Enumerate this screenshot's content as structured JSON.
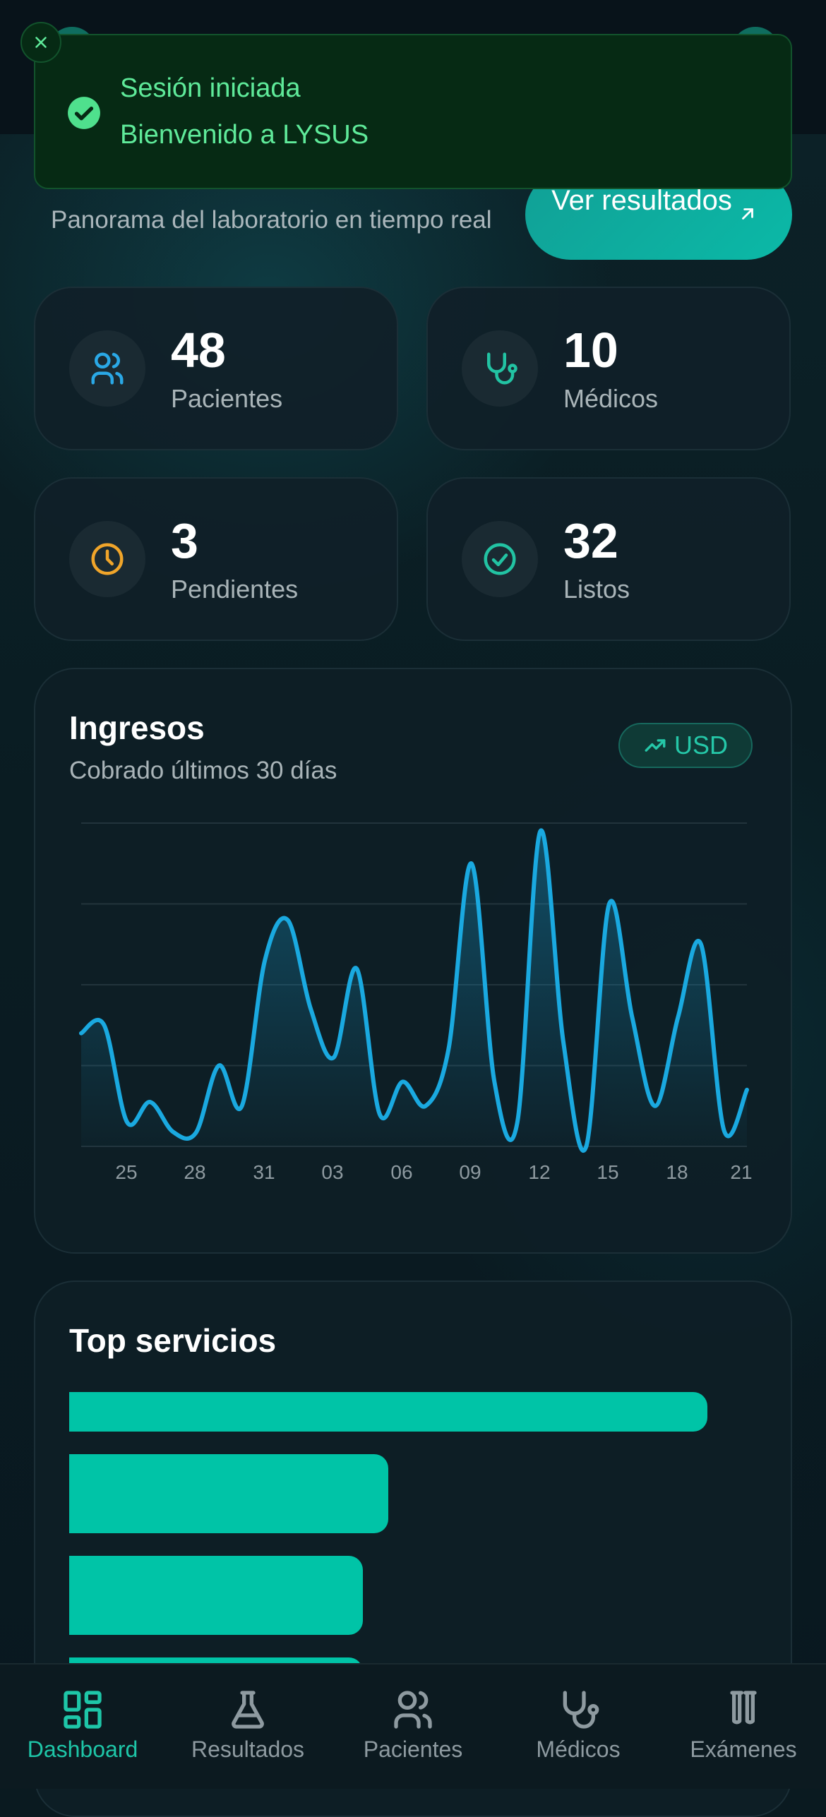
{
  "header": {
    "subtitle": "Panorama del laboratorio en tiempo real",
    "results_button": "Ver resultados"
  },
  "stats": [
    {
      "value": "48",
      "label": "Pacientes",
      "icon": "users-icon"
    },
    {
      "value": "10",
      "label": "Médicos",
      "icon": "stethoscope-icon"
    },
    {
      "value": "3",
      "label": "Pendientes",
      "icon": "clock-icon"
    },
    {
      "value": "32",
      "label": "Listos",
      "icon": "check-circle-icon"
    }
  ],
  "income": {
    "title": "Ingresos",
    "subtitle": "Cobrado últimos 30 días",
    "currency": "USD"
  },
  "chart_data": {
    "type": "area",
    "x_ticks": [
      "25",
      "28",
      "31",
      "03",
      "06",
      "09",
      "12",
      "15",
      "18",
      "21"
    ],
    "values": [
      1.4,
      1.5,
      0.3,
      0.55,
      0.18,
      0.17,
      1.0,
      0.5,
      2.3,
      2.8,
      1.7,
      1.1,
      2.2,
      0.4,
      0.8,
      0.5,
      1.2,
      3.5,
      0.8,
      0.3,
      3.9,
      1.3,
      0.0,
      3.0,
      1.6,
      0.5,
      1.6,
      2.5,
      0.2,
      0.7
    ],
    "ylim": [
      0,
      4
    ],
    "grid": true,
    "colors": {
      "line": "#1aa9e0",
      "accent": "#00c4a7"
    }
  },
  "top_services": {
    "title": "Top servicios",
    "bars": [
      1.0,
      0.5,
      0.46,
      0.46
    ]
  },
  "toast": {
    "title": "Sesión iniciada",
    "message": "Bienvenido a LYSUS"
  },
  "nav": [
    {
      "label": "Dashboard",
      "icon": "dashboard-icon",
      "active": true
    },
    {
      "label": "Resultados",
      "icon": "flask-icon"
    },
    {
      "label": "Pacientes",
      "icon": "users-icon"
    },
    {
      "label": "Médicos",
      "icon": "stethoscope-icon"
    },
    {
      "label": "Exámenes",
      "icon": "test-tubes-icon"
    }
  ]
}
